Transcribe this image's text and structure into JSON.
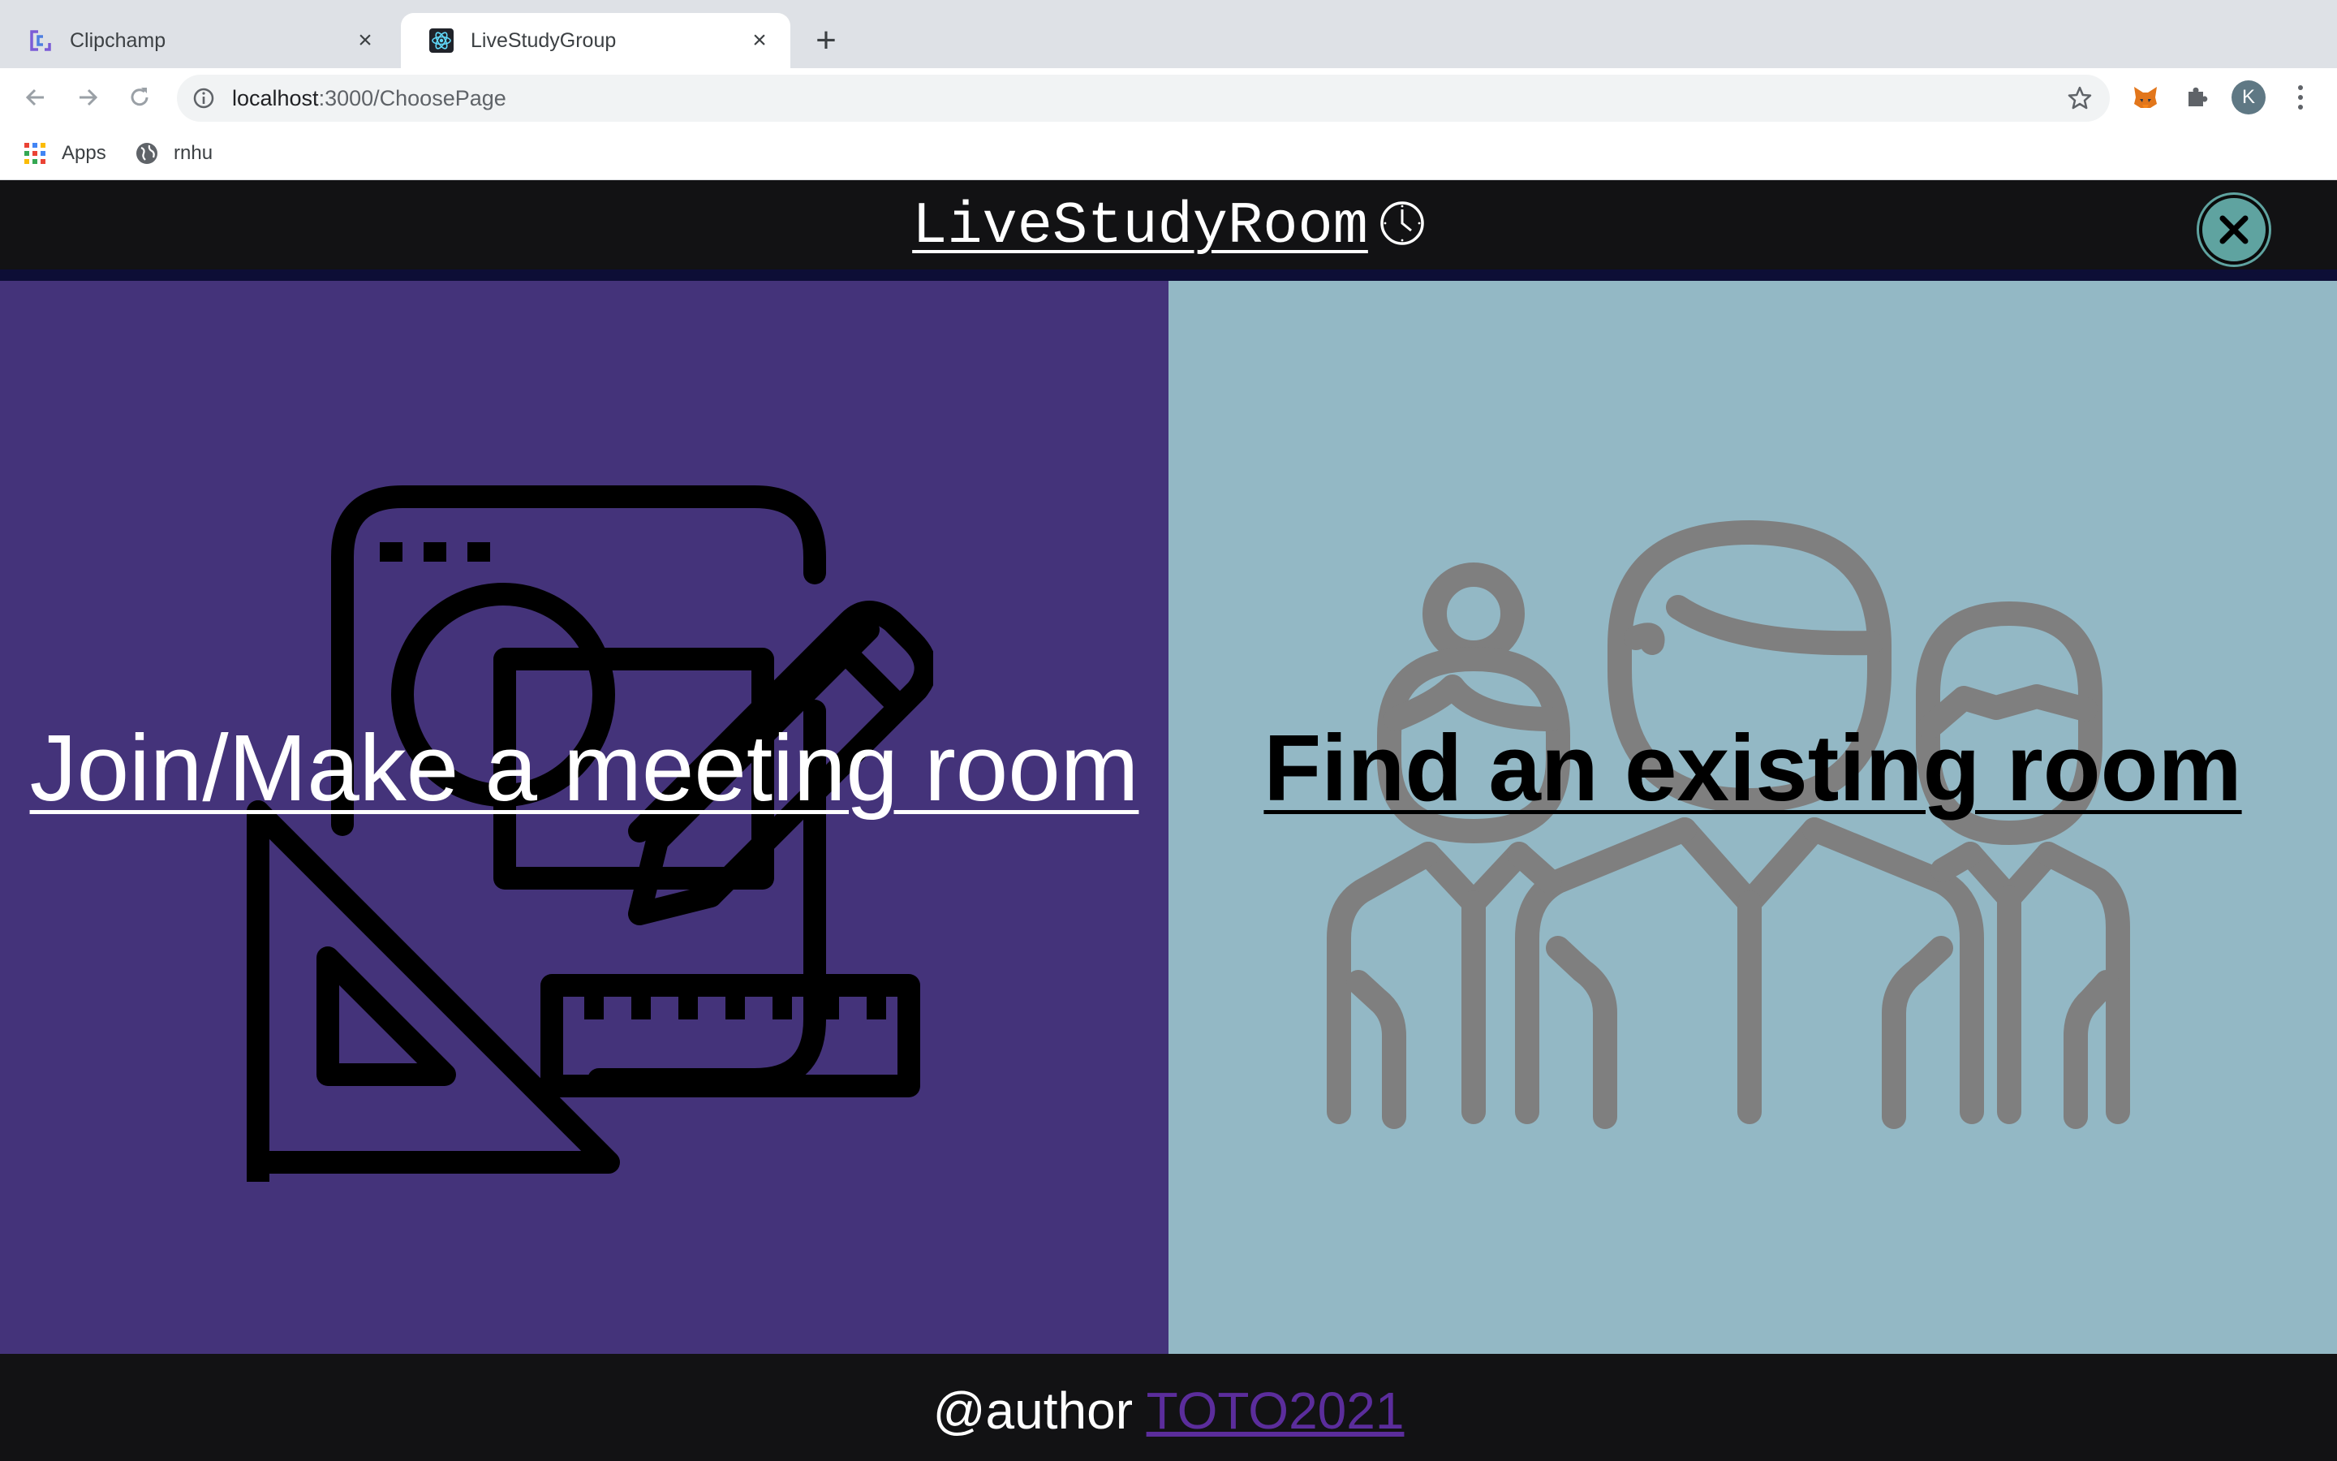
{
  "browser": {
    "tabs": [
      {
        "title": "Clipchamp",
        "icon": "clipchamp-icon",
        "active": false
      },
      {
        "title": "LiveStudyGroup",
        "icon": "react-icon",
        "active": true
      }
    ],
    "url_host": "localhost",
    "url_path": ":3000/ChoosePage",
    "bookmarks": [
      {
        "label": "Apps",
        "icon": "apps-grid-icon"
      },
      {
        "label": "rnhu",
        "icon": "globe-icon"
      }
    ],
    "profile_initial": "K"
  },
  "header": {
    "title": "LiveStudyRoom",
    "title_icon": "clock-icon",
    "close_icon": "close-icon"
  },
  "panels": {
    "left": {
      "label": "Join/Make a meeting room",
      "background": "#44337a",
      "illustration": "design-tools-icon"
    },
    "right": {
      "label": "Find an existing room",
      "background": "#93b8c5",
      "illustration": "group-people-icon"
    }
  },
  "footer": {
    "prefix": "@author",
    "link": "TOTO2021"
  },
  "colors": {
    "header_bg": "#121214",
    "close_button": "#5fa3a0",
    "footer_link": "#5b2d9c"
  }
}
